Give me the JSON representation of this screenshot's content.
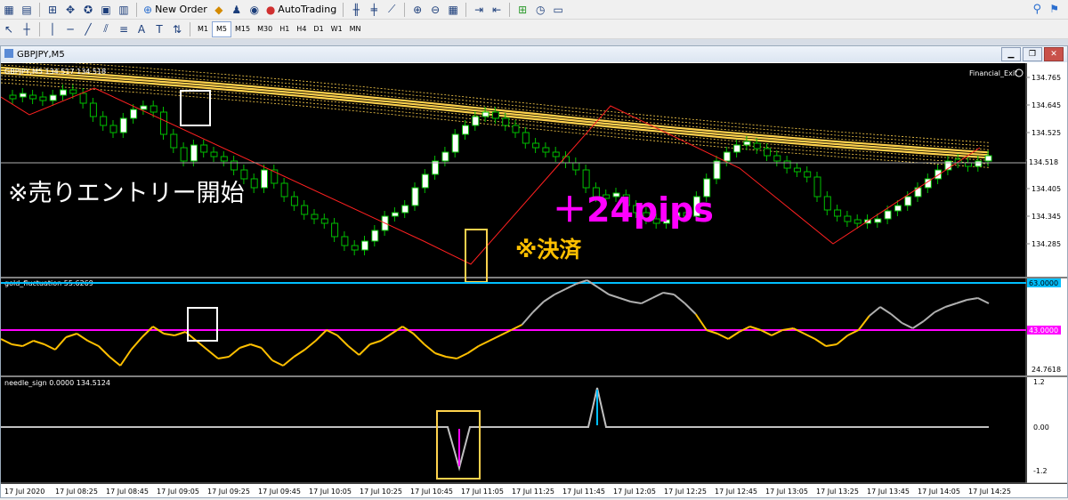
{
  "toolbar": {
    "new_order": "New Order",
    "autotrading": "AutoTrading",
    "timeframes": [
      "M1",
      "M5",
      "M15",
      "M30",
      "H1",
      "H4",
      "D1",
      "W1",
      "MN"
    ],
    "active_timeframe": "M5"
  },
  "window": {
    "title": "GBPJPY,M5"
  },
  "main_panel": {
    "header": "GBPJPY,M5  134.517 134.518",
    "ea_label": "Financial_Exit",
    "price_labels": [
      "134.765",
      "134.645",
      "134.525",
      "134.518",
      "134.465",
      "134.405",
      "134.345",
      "134.285"
    ],
    "current_price": "134.518",
    "annotations": {
      "entry": "※売りエントリー開始",
      "profit": "＋24pips",
      "exit": "※決済"
    }
  },
  "indicator1": {
    "name": "gold_fluctuation 55.6269",
    "level_upper": "63.0000",
    "level_lower": "43.0000",
    "min_label": "24.7618"
  },
  "indicator2": {
    "name": "needle_sign 0.0000 134.5124",
    "labels": [
      "1.2",
      "0.00",
      "-1.2"
    ]
  },
  "time_axis": [
    "17 Jul 2020",
    "17 Jul 08:25",
    "17 Jul 08:45",
    "17 Jul 09:05",
    "17 Jul 09:25",
    "17 Jul 09:45",
    "17 Jul 10:05",
    "17 Jul 10:25",
    "17 Jul 10:45",
    "17 Jul 11:05",
    "17 Jul 11:25",
    "17 Jul 11:45",
    "17 Jul 12:05",
    "17 Jul 12:25",
    "17 Jul 12:45",
    "17 Jul 13:05",
    "17 Jul 13:25",
    "17 Jul 13:45",
    "17 Jul 14:05",
    "17 Jul 14:25"
  ],
  "colors": {
    "bull": "#ffffff",
    "bear_outline": "#00c000",
    "wick": "#00c000",
    "zigzag": "#ff2020",
    "band": "#ffd24d",
    "osc_yellow": "#ffc000",
    "osc_gray": "#b0b0b0",
    "level_magenta": "#ff00ff",
    "level_cyan": "#00bfff",
    "profit_text": "#ff00ff",
    "exit_text": "#ffc000",
    "box_white": "#ffffff",
    "box_yellow": "#ffd24d"
  }
}
